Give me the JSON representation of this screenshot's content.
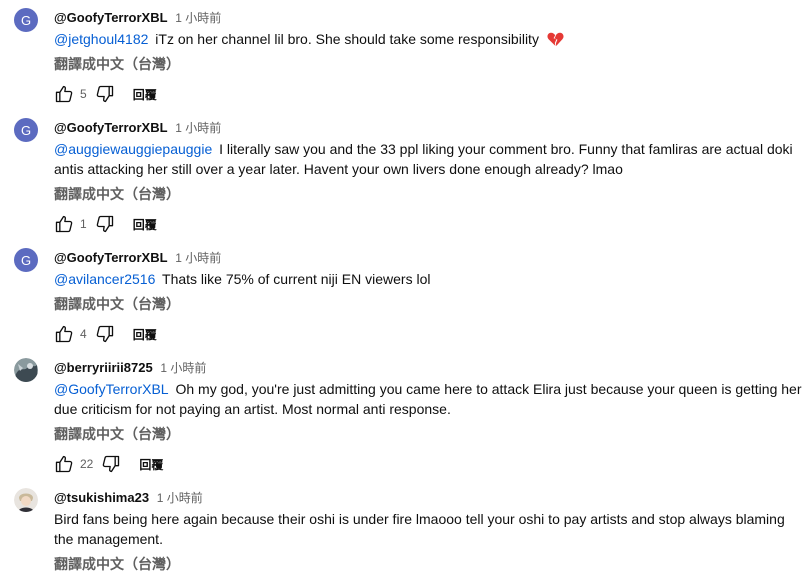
{
  "ui": {
    "translate_label": "翻譯成中文（台灣）",
    "reply_label": "回覆"
  },
  "comments": [
    {
      "avatar_letter": "G",
      "author": "@GoofyTerrorXBL",
      "time": "1 小時前",
      "mention": "@jetghoul4182",
      "text": "iTz on her channel lil bro. She should take some responsibility",
      "likes": "5"
    },
    {
      "avatar_letter": "G",
      "author": "@GoofyTerrorXBL",
      "time": "1 小時前",
      "mention": "@auggiewauggiepauggie",
      "text": "I literally saw you and the 33 ppl liking your comment bro. Funny that famliras are actual doki antis attacking her still over a year later. Havent your own livers done enough already? lmao",
      "likes": "1"
    },
    {
      "avatar_letter": "G",
      "author": "@GoofyTerrorXBL",
      "time": "1 小時前",
      "mention": "@avilancer2516",
      "text": "Thats like 75% of current niji EN viewers lol",
      "likes": "4"
    },
    {
      "author": "@berryriirii8725",
      "time": "1 小時前",
      "mention": "@GoofyTerrorXBL",
      "text": "Oh my god, you're just admitting you came here to attack Elira just because your queen is getting her due criticism for not paying an artist. Most normal anti response.",
      "likes": "22"
    },
    {
      "author": "@tsukishima23",
      "time": "1 小時前",
      "mention": "",
      "text": "Bird fans being here again because their oshi is under fire lmaooo tell your oshi to pay artists and stop always blaming the management."
    }
  ]
}
